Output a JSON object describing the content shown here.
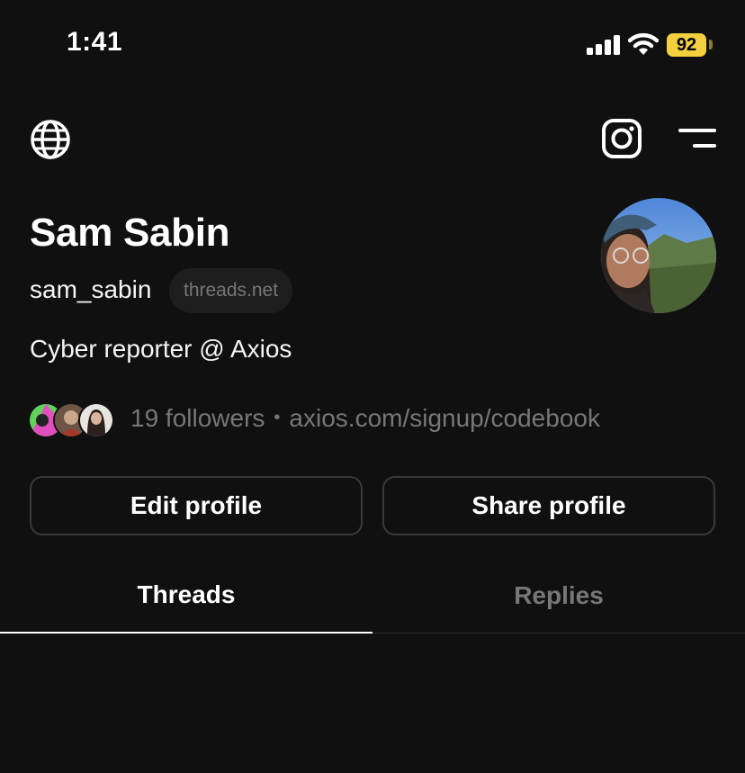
{
  "status_bar": {
    "time": "1:41",
    "battery": "92",
    "icons": [
      "signal-icon",
      "wifi-icon",
      "battery-icon"
    ]
  },
  "top_bar": {
    "icons": [
      "globe-icon",
      "instagram-icon",
      "menu-icon"
    ]
  },
  "profile": {
    "name": "Sam Sabin",
    "handle": "sam_sabin",
    "domain_badge": "threads.net",
    "bio": "Cyber reporter @ Axios",
    "followers_text": "19 followers",
    "separator": "•",
    "link": "axios.com/signup/codebook"
  },
  "buttons": {
    "edit_profile": "Edit profile",
    "share_profile": "Share profile"
  },
  "tabs": [
    {
      "label": "Threads",
      "active": true
    },
    {
      "label": "Replies",
      "active": false
    }
  ],
  "colors": {
    "background": "#101010",
    "primary_text": "#f3f5f7",
    "secondary_text": "#777777",
    "button_border": "#3a3a3a",
    "battery": "#f4d03f"
  }
}
